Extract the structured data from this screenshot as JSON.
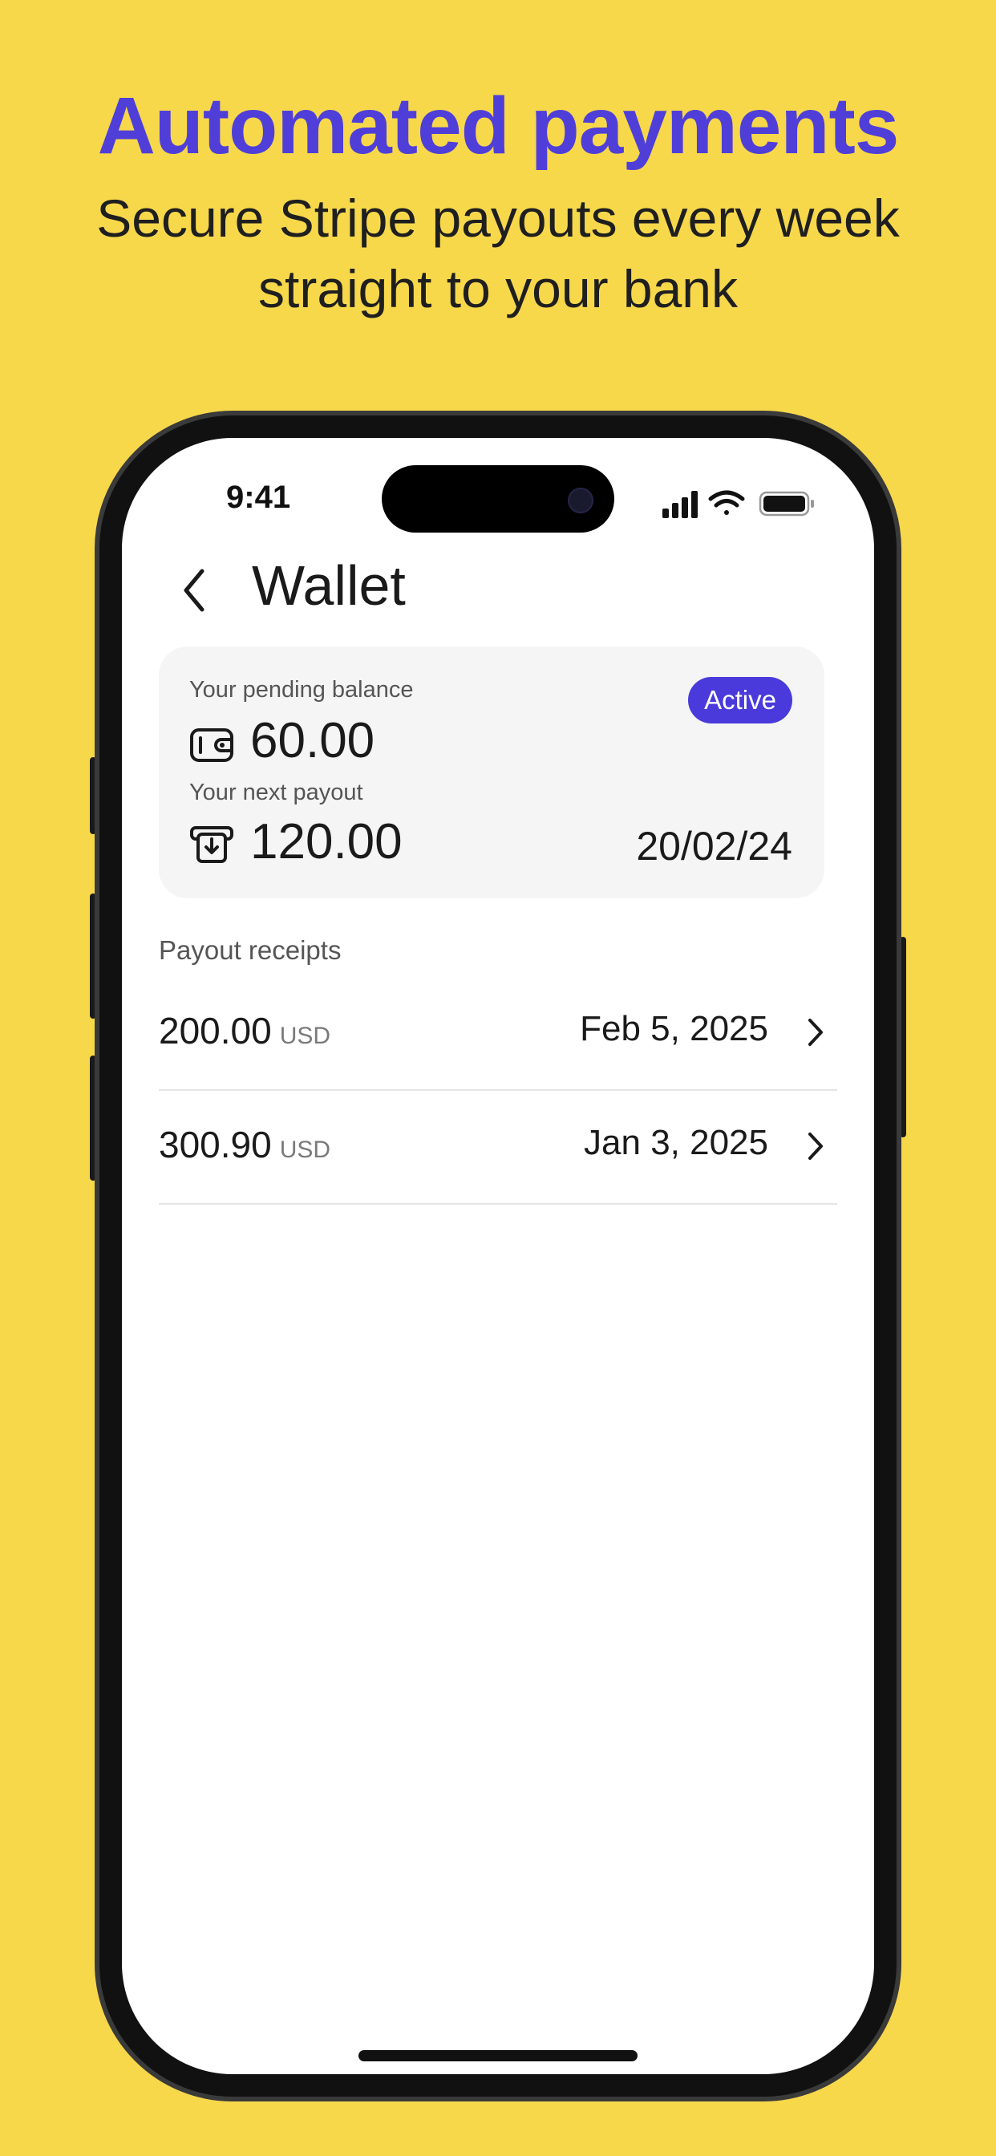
{
  "header": {
    "title": "Automated payments",
    "subtitle_lines": [
      "Secure Stripe payouts every week",
      "straight to your bank"
    ]
  },
  "status_bar": {
    "time": "9:41",
    "icons": [
      "signal-icon",
      "wifi-icon",
      "battery-icon"
    ]
  },
  "screen": {
    "title": "Wallet",
    "back_icon": "chevron-left-icon"
  },
  "balance_card": {
    "pending_label": "Your pending balance",
    "pending_value": "60.00",
    "pending_icon": "wallet-icon",
    "status_badge": "Active",
    "next_label": "Your next payout",
    "next_value": "120.00",
    "next_icon": "payout-icon",
    "next_date": "20/02/24"
  },
  "receipts": {
    "title": "Payout receipts",
    "items": [
      {
        "amount": "200.00",
        "currency": "USD",
        "date": "Feb 5, 2025"
      },
      {
        "amount": "300.90",
        "currency": "USD",
        "date": "Jan 3, 2025"
      }
    ]
  },
  "colors": {
    "background": "#F7D84B",
    "accent": "#4F3FD8",
    "badge": "#4A3ADB"
  }
}
